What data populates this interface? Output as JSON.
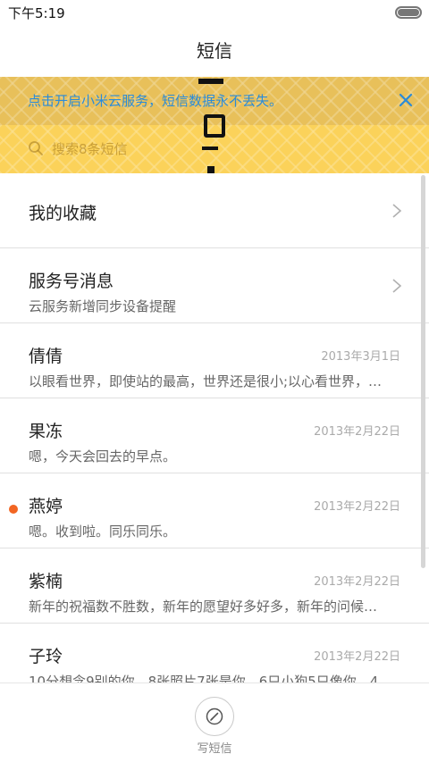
{
  "status_bar": {
    "time": "下午5:19"
  },
  "header": {
    "title": "短信"
  },
  "banner": {
    "notice": "点击开启小米云服务，短信数据永不丢失。",
    "search_placeholder": "搜索8条短信"
  },
  "threads": [
    {
      "name": "我的收藏",
      "snippet": "",
      "date": "",
      "chevron": true,
      "unread": false
    },
    {
      "name": "服务号消息",
      "snippet": "云服务新增同步设备提醒",
      "date": "",
      "chevron": true,
      "unread": false
    },
    {
      "name": "倩倩",
      "snippet": "以眼看世界，即使站的最高，世界还是很小;以心看世界，…",
      "date": "2013年3月1日",
      "chevron": false,
      "unread": false
    },
    {
      "name": "果冻",
      "snippet": "嗯，今天会回去的早点。",
      "date": "2013年2月22日",
      "chevron": false,
      "unread": false
    },
    {
      "name": "燕婷",
      "snippet": "嗯。收到啦。同乐同乐。",
      "date": "2013年2月22日",
      "chevron": false,
      "unread": true
    },
    {
      "name": "紫楠",
      "snippet": "新年的祝福数不胜数，新年的愿望好多好多，新年的问候…",
      "date": "2013年2月22日",
      "chevron": false,
      "unread": false
    },
    {
      "name": "子玲",
      "snippet": "10分想念9别的你，8张照片7张是你，6只小狗5只像你，4…",
      "date": "2013年2月22日",
      "chevron": false,
      "unread": false
    }
  ],
  "bottom_bar": {
    "compose_label": "写短信",
    "compose_icon": "compose-pen-icon"
  },
  "colors": {
    "banner_bg": "#fbd25a",
    "notice_text": "#2a8bd8",
    "unread_dot": "#f26522"
  }
}
